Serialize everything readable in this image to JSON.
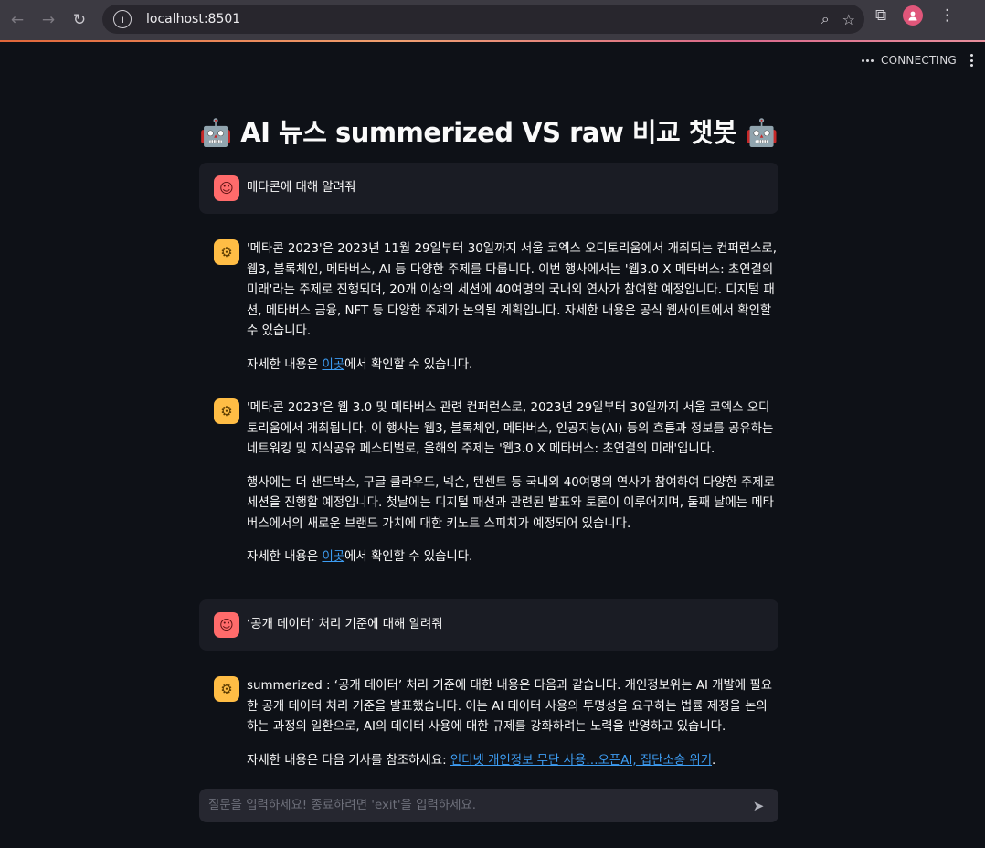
{
  "browser": {
    "url": "localhost:8501",
    "back_icon": "←",
    "forward_icon": "→",
    "reload_icon": "↻",
    "info_icon": "i",
    "zoom_icon": "⌕",
    "star_icon": "☆",
    "extensions_icon": "⧉",
    "menu_icon": "⋮"
  },
  "app": {
    "status_text": "CONNECTING",
    "title": "🤖 AI 뉴스 summerized VS raw 비교 챗봇 🤖"
  },
  "messages": [
    {
      "role": "user",
      "avatar_icon": "☺",
      "paragraphs": [
        "메타콘에 대해 알려줘"
      ]
    },
    {
      "role": "assistant",
      "avatar_icon": "⚙",
      "paragraphs": [
        "'메타콘 2023'은 2023년 11월 29일부터 30일까지 서울 코엑스 오디토리움에서 개최되는 컨퍼런스로, 웹3, 블록체인, 메타버스, AI 등 다양한 주제를 다룹니다. 이번 행사에서는 '웹3.0 X 메타버스: 초연결의 미래'라는 주제로 진행되며, 20개 이상의 세션에 40여명의 국내외 연사가 참여할 예정입니다. 디지털 패션, 메타버스 금융, NFT 등 다양한 주제가 논의될 계획입니다. 자세한 내용은 공식 웹사이트에서 확인할 수 있습니다."
      ],
      "link_prefix": "자세한 내용은 ",
      "link_text": "이곳",
      "link_suffix": "에서 확인할 수 있습니다."
    },
    {
      "role": "assistant",
      "avatar_icon": "⚙",
      "paragraphs": [
        "'메타콘 2023'은 웹 3.0 및 메타버스 관련 컨퍼런스로, 2023년 29일부터 30일까지 서울 코엑스 오디토리움에서 개최됩니다. 이 행사는 웹3, 블록체인, 메타버스, 인공지능(AI) 등의 흐름과 정보를 공유하는 네트워킹 및 지식공유 페스티벌로, 올해의 주제는 '웹3.0 X 메타버스: 초연결의 미래'입니다.",
        "행사에는 더 샌드박스, 구글 클라우드, 넥슨, 텐센트 등 국내외 40여명의 연사가 참여하여 다양한 주제로 세션을 진행할 예정입니다. 첫날에는 디지털 패션과 관련된 발표와 토론이 이루어지며, 둘째 날에는 메타버스에서의 새로운 브랜드 가치에 대한 키노트 스피치가 예정되어 있습니다."
      ],
      "link_prefix": "자세한 내용은 ",
      "link_text": "이곳",
      "link_suffix": "에서 확인할 수 있습니다."
    },
    {
      "role": "user",
      "avatar_icon": "☺",
      "paragraphs": [
        "‘공개 데이터’ 처리 기준에 대해 알려줘"
      ]
    },
    {
      "role": "assistant",
      "avatar_icon": "⚙",
      "paragraphs": [
        "summerized : ‘공개 데이터’ 처리 기준에 대한 내용은 다음과 같습니다. 개인정보위는 AI 개발에 필요한 공개 데이터 처리 기준을 발표했습니다. 이는 AI 데이터 사용의 투명성을 요구하는 법률 제정을 논의하는 과정의 일환으로, AI의 데이터 사용에 대한 규제를 강화하려는 노력을 반영하고 있습니다."
      ],
      "link_prefix": "자세한 내용은 다음 기사를 참조하세요: ",
      "link_text": "인터넷 개인정보 무단 사용…오픈AI, 집단소송 위기",
      "link_suffix": "."
    }
  ],
  "input": {
    "placeholder": "질문을 입력하세요! 종료하려면 'exit'을 입력하세요.",
    "send_icon": "➤"
  }
}
